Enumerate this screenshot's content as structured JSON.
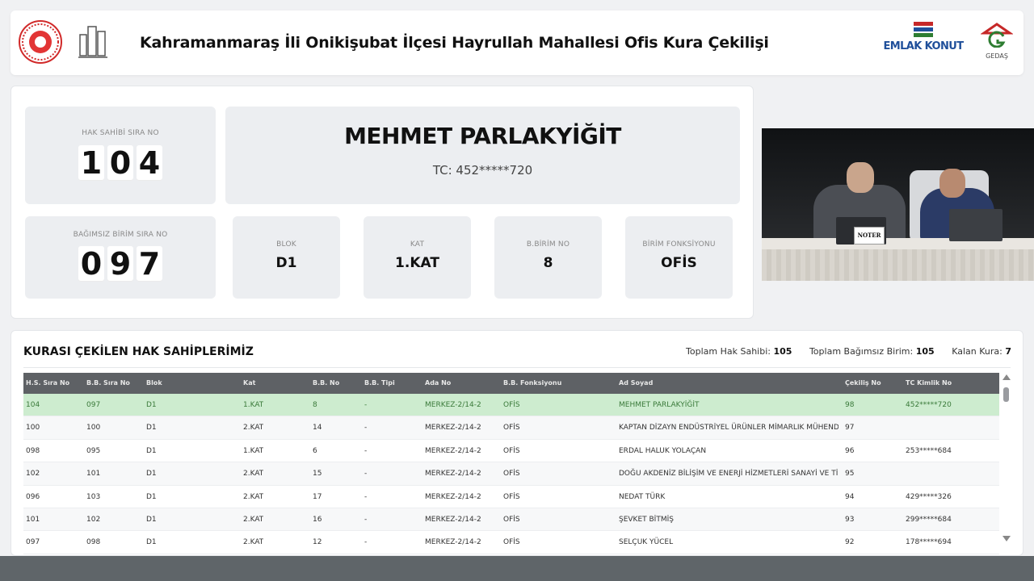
{
  "header": {
    "title": "Kahramanmaraş İli Onikişubat İlçesi Hayrullah Mahallesi Ofis Kura Çekilişi",
    "logo_emlak_text": "EMLAK KONUT",
    "logo_gedas_text": "GEDAŞ",
    "accent_color": "#1f4f9a"
  },
  "current": {
    "hak_sahibi_label": "HAK SAHİBİ SIRA NO",
    "hak_sahibi_digits": [
      "1",
      "0",
      "4"
    ],
    "bagimsiz_label": "BAĞIMSIZ BİRİM SIRA NO",
    "bagimsiz_digits": [
      "0",
      "9",
      "7"
    ],
    "name": "MEHMET PARLAKYİĞİT",
    "tc": "TC: 452*****720",
    "fields": [
      {
        "label": "BLOK",
        "value": "D1"
      },
      {
        "label": "KAT",
        "value": "1.KAT"
      },
      {
        "label": "B.BİRİM NO",
        "value": "8"
      },
      {
        "label": "BİRİM FONKSİYONU",
        "value": "OFİS"
      }
    ]
  },
  "video": {
    "sign_text": "NOTER"
  },
  "list": {
    "title": "KURASI ÇEKİLEN HAK SAHİPLERİMİZ",
    "stats": [
      {
        "label": "Toplam Hak Sahibi:",
        "value": "105"
      },
      {
        "label": "Toplam Bağımsız Birim:",
        "value": "105"
      },
      {
        "label": "Kalan Kura:",
        "value": "7"
      }
    ],
    "columns": [
      "H.S. Sıra No",
      "B.B. Sıra No",
      "Blok",
      "Kat",
      "B.B. No",
      "B.B. Tipi",
      "Ada No",
      "B.B. Fonksiyonu",
      "Ad Soyad",
      "Çekiliş No",
      "TC Kimlik No"
    ],
    "rows": [
      [
        "104",
        "097",
        "D1",
        "1.KAT",
        "8",
        "-",
        "MERKEZ-2/14-2",
        "OFİS",
        "MEHMET PARLAKYİĞİT",
        "98",
        "452*****720"
      ],
      [
        "100",
        "100",
        "D1",
        "2.KAT",
        "14",
        "-",
        "MERKEZ-2/14-2",
        "OFİS",
        "KAPTAN DİZAYN ENDÜSTRİYEL ÜRÜNLER MİMARLIK MÜHENDİ...",
        "97",
        ""
      ],
      [
        "098",
        "095",
        "D1",
        "1.KAT",
        "6",
        "-",
        "MERKEZ-2/14-2",
        "OFİS",
        "ERDAL HALUK YOLAÇAN",
        "96",
        "253*****684"
      ],
      [
        "102",
        "101",
        "D1",
        "2.KAT",
        "15",
        "-",
        "MERKEZ-2/14-2",
        "OFİS",
        "DOĞU AKDENİZ BİLİŞİM VE ENERJİ HİZMETLERİ SANAYİ VE Tİ...",
        "95",
        ""
      ],
      [
        "096",
        "103",
        "D1",
        "2.KAT",
        "17",
        "-",
        "MERKEZ-2/14-2",
        "OFİS",
        "NEDAT TÜRK",
        "94",
        "429*****326"
      ],
      [
        "101",
        "102",
        "D1",
        "2.KAT",
        "16",
        "-",
        "MERKEZ-2/14-2",
        "OFİS",
        "ŞEVKET BİTMİŞ",
        "93",
        "299*****684"
      ],
      [
        "097",
        "098",
        "D1",
        "2.KAT",
        "12",
        "-",
        "MERKEZ-2/14-2",
        "OFİS",
        "SELÇUK YÜCEL",
        "92",
        "178*****694"
      ]
    ],
    "highlight_color": "#cdeccf"
  }
}
